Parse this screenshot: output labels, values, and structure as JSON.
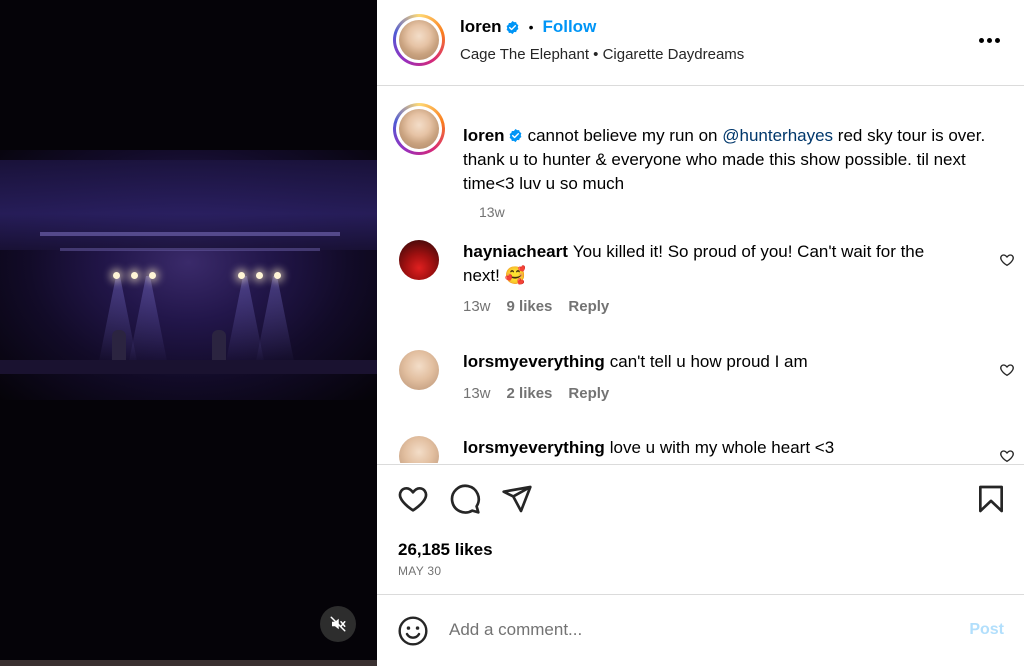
{
  "post": {
    "author": "loren",
    "follow_label": "Follow",
    "music": "Cage The Elephant • Cigarette Daydreams",
    "caption_prefix": "cannot believe my run on ",
    "caption_mention": "@hunterhayes",
    "caption_suffix": " red sky tour is over. thank u to hunter & everyone who made this show possible. til next time<3 luv u so much",
    "caption_time": "13w",
    "likes_text": "26,185 likes",
    "date": "MAY 30"
  },
  "comments": [
    {
      "user": "hayniacheart",
      "text": "You killed it! So proud of you! Can't wait for the next! 🥰",
      "time": "13w",
      "likes": "9 likes",
      "reply": "Reply"
    },
    {
      "user": "lorsmyeverything",
      "text": "can't tell u how proud I am",
      "time": "13w",
      "likes": "2 likes",
      "reply": "Reply"
    },
    {
      "user": "lorsmyeverything",
      "text": "love u with my whole heart <3"
    }
  ],
  "compose": {
    "placeholder": "Add a comment...",
    "post_label": "Post"
  },
  "icons": {
    "mute": "speaker-muted-icon",
    "more": "more-options-icon",
    "like": "heart-icon",
    "comment": "comment-bubble-icon",
    "share": "share-paper-plane-icon",
    "save": "bookmark-icon",
    "emoji": "emoji-smiley-icon",
    "verified": "verified-badge-icon"
  },
  "colors": {
    "accent": "#0095f6",
    "mention": "#00376b",
    "muted_text": "#737373",
    "divider": "#dbdbdb",
    "post_disabled": "#b2dffc"
  }
}
